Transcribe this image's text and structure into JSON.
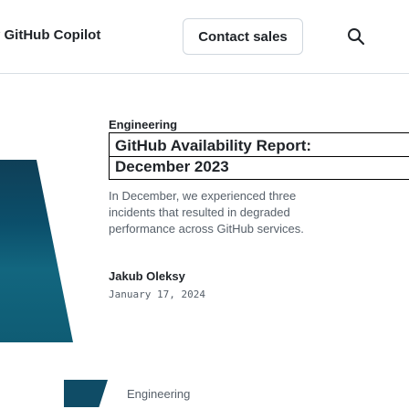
{
  "nav": {
    "copilot_label": "y GitHub Copilot",
    "contact_label": "Contact sales",
    "search_icon": "search-icon"
  },
  "post": {
    "category": "Engineering",
    "title_line1": "GitHub Availability Report:",
    "title_line2": "December 2023",
    "excerpt_lines": [
      "In December, we experienced three",
      "incidents that resulted in degraded",
      "performance across GitHub services."
    ],
    "author": "Jakub Oleksy",
    "date": "January 17, 2024"
  },
  "next_post": {
    "category": "Engineering"
  },
  "colors": {
    "text": "#1f2328",
    "muted": "#57606a",
    "border": "#d0d7de",
    "thumb": "#0b4f6b"
  }
}
